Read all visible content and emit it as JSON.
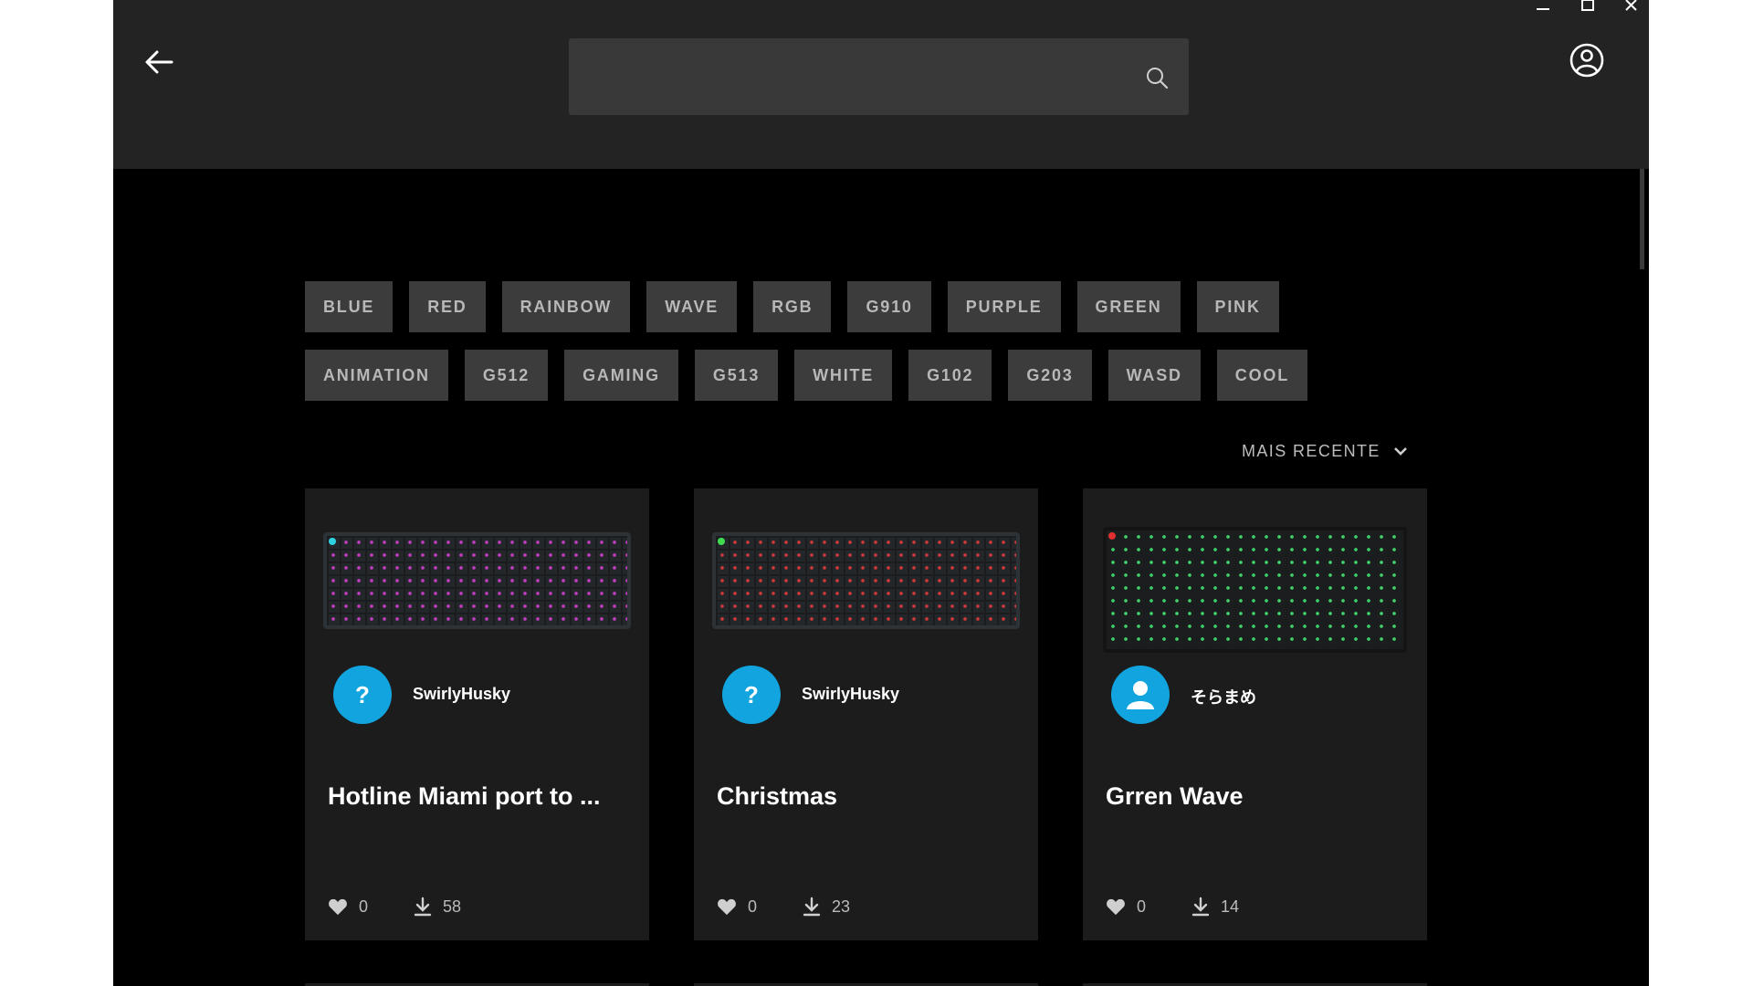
{
  "window": {
    "minimize": "minimize",
    "maximize": "maximize",
    "close": "close"
  },
  "header": {
    "back_icon": "arrow-left-icon",
    "search": {
      "placeholder": "",
      "icon": "search-icon"
    },
    "account_icon": "user-circle-icon"
  },
  "tags": {
    "row1": [
      "BLUE",
      "RED",
      "RAINBOW",
      "WAVE",
      "RGB",
      "G910",
      "PURPLE",
      "GREEN",
      "PINK"
    ],
    "row2": [
      "ANIMATION",
      "G512",
      "GAMING",
      "G513",
      "WHITE",
      "G102",
      "G203",
      "WASD",
      "COOL"
    ]
  },
  "sort": {
    "label": "MAIS RECENTE",
    "icon": "chevron-down-icon"
  },
  "cards": [
    {
      "author": "SwirlyHusky",
      "avatar": "?",
      "title": "Hotline Miami port to ...",
      "likes": "0",
      "downloads": "58"
    },
    {
      "author": "SwirlyHusky",
      "avatar": "?",
      "title": "Christmas",
      "likes": "0",
      "downloads": "23"
    },
    {
      "author": "そらまめ",
      "avatar": "user",
      "title": "Grren Wave",
      "likes": "0",
      "downloads": "14"
    }
  ],
  "colors": {
    "accent": "#12a4de",
    "header_bg": "#232323",
    "tag_bg": "#3c3c3c",
    "card_bg": "#1c1c1c"
  }
}
